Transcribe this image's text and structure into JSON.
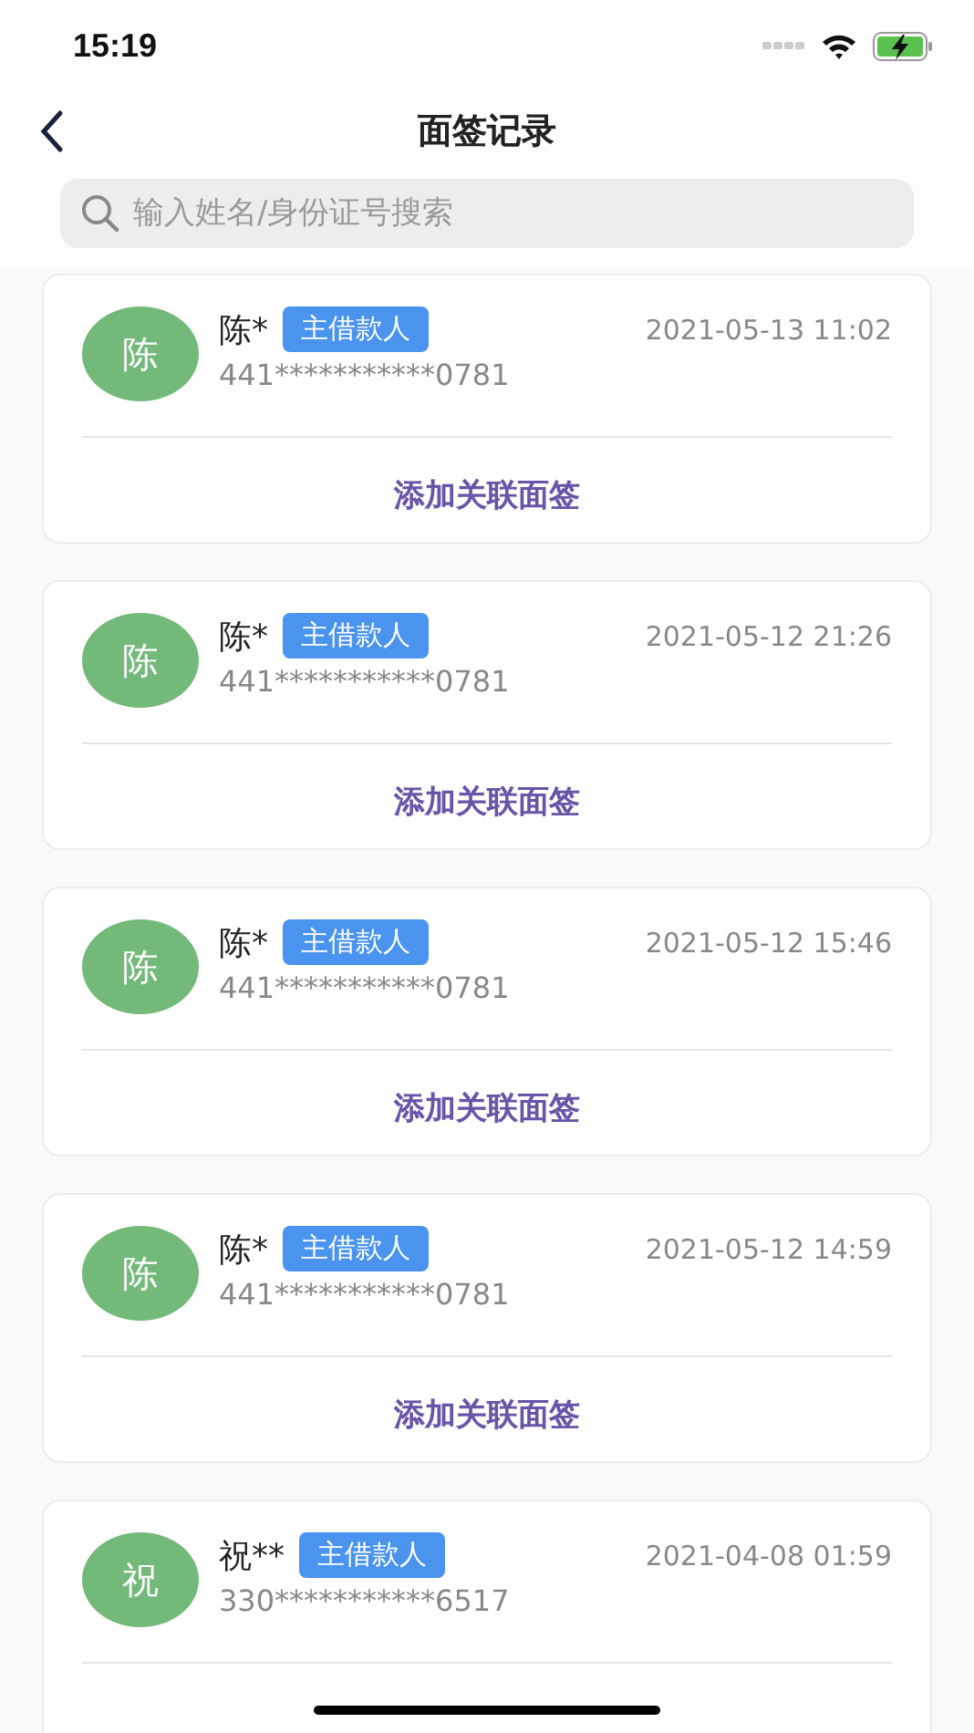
{
  "status_bar": {
    "time": "15:19"
  },
  "header": {
    "title": "面签记录"
  },
  "search": {
    "placeholder": "输入姓名/身份证号搜索"
  },
  "records": [
    {
      "avatar": "陈",
      "name": "陈*",
      "role": "主借款人",
      "time": "2021-05-13 11:02",
      "id_number": "441***********0781",
      "action": "添加关联面签"
    },
    {
      "avatar": "陈",
      "name": "陈*",
      "role": "主借款人",
      "time": "2021-05-12 21:26",
      "id_number": "441***********0781",
      "action": "添加关联面签"
    },
    {
      "avatar": "陈",
      "name": "陈*",
      "role": "主借款人",
      "time": "2021-05-12 15:46",
      "id_number": "441***********0781",
      "action": "添加关联面签"
    },
    {
      "avatar": "陈",
      "name": "陈*",
      "role": "主借款人",
      "time": "2021-05-12 14:59",
      "id_number": "441***********0781",
      "action": "添加关联面签"
    },
    {
      "avatar": "祝",
      "name": "祝**",
      "role": "主借款人",
      "time": "2021-04-08 01:59",
      "id_number": "330***********6517"
    }
  ]
}
